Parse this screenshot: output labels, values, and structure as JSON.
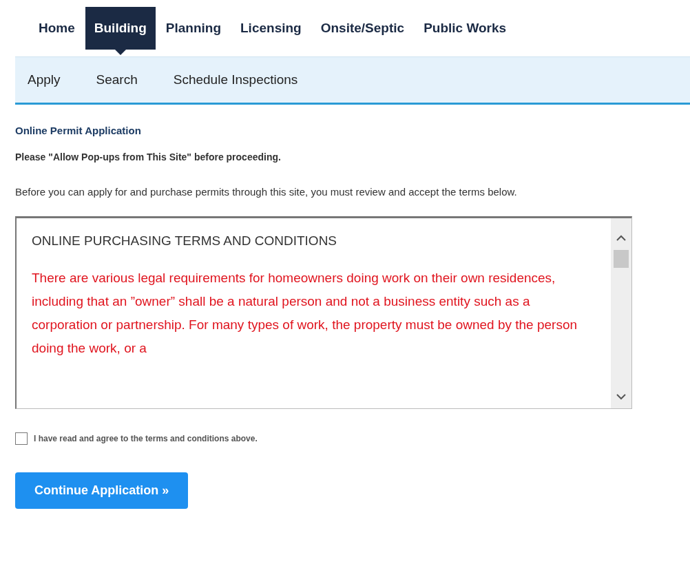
{
  "main_nav": [
    {
      "label": "Home",
      "selected": false
    },
    {
      "label": "Building",
      "selected": true
    },
    {
      "label": "Planning",
      "selected": false
    },
    {
      "label": "Licensing",
      "selected": false
    },
    {
      "label": "Onsite/Septic",
      "selected": false
    },
    {
      "label": "Public Works",
      "selected": false
    }
  ],
  "sub_nav": [
    "Apply",
    "Search",
    "Schedule Inspections"
  ],
  "heading": "Online Permit Application",
  "notice": "Please \"Allow Pop-ups from This Site\" before proceeding.",
  "intro": "Before you can apply for and purchase permits through this site, you must review and accept the terms below.",
  "terms": {
    "title": "ONLINE PURCHASING TERMS AND CONDITIONS",
    "body": "There are various legal requirements for homeowners doing work on their own residences, including that an ”owner” shall be a natural person and not a business entity such as a corporation or partnership. For many types of work, the property must be owned by the person doing the work, or a"
  },
  "agree": {
    "label": "I have read and agree to the terms and conditions above.",
    "checked": false
  },
  "continue_button": "Continue Application »"
}
